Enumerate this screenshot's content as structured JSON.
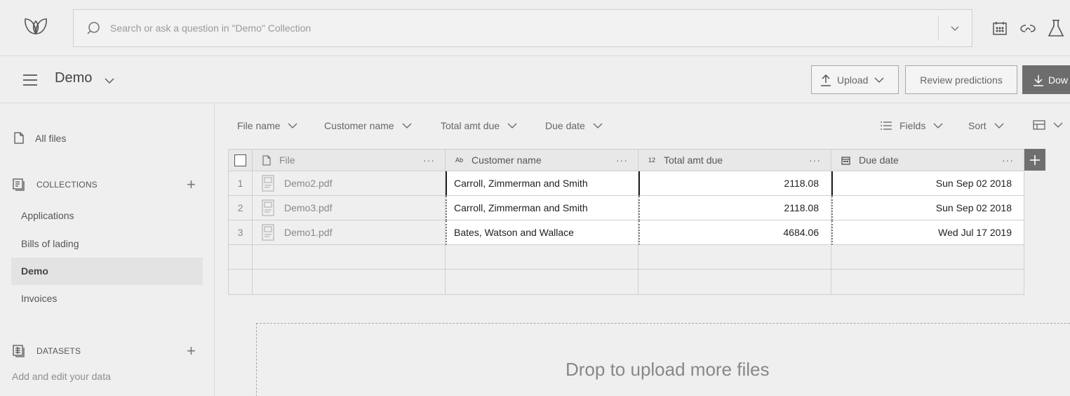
{
  "search": {
    "placeholder": "Search or ask a question in \"Demo\" Collection"
  },
  "header": {
    "collection_title": "Demo",
    "upload_label": "Upload",
    "review_label": "Review predictions",
    "download_label": "Dow"
  },
  "sidebar": {
    "all_files": "All files",
    "collections_heading": "COLLECTIONS",
    "collections": [
      {
        "label": "Applications",
        "active": false
      },
      {
        "label": "Bills of lading",
        "active": false
      },
      {
        "label": "Demo",
        "active": true
      },
      {
        "label": "Invoices",
        "active": false
      }
    ],
    "datasets_heading": "DATASETS",
    "datasets_subtitle": "Add and edit your data"
  },
  "filters": {
    "file_name": "File name",
    "customer_name": "Customer name",
    "total_amt_due": "Total amt due",
    "due_date": "Due date",
    "fields": "Fields",
    "sort": "Sort"
  },
  "table": {
    "columns": [
      {
        "label": "File",
        "type_tag": ""
      },
      {
        "label": "Customer name",
        "type_tag": "Ab"
      },
      {
        "label": "Total amt due",
        "type_tag": "12"
      },
      {
        "label": "Due date",
        "type_tag": ""
      }
    ],
    "rows": [
      {
        "num": "1",
        "file": "Demo2.pdf",
        "customer": "Carroll, Zimmerman and Smith",
        "total": "2118.08",
        "due": "Sun Sep 02 2018"
      },
      {
        "num": "2",
        "file": "Demo3.pdf",
        "customer": "Carroll, Zimmerman and Smith",
        "total": "2118.08",
        "due": "Sun Sep 02 2018"
      },
      {
        "num": "3",
        "file": "Demo1.pdf",
        "customer": "Bates, Watson and Wallace",
        "total": "4684.06",
        "due": "Wed Jul 17 2019"
      }
    ]
  },
  "dropzone": {
    "label": "Drop to upload more files"
  }
}
